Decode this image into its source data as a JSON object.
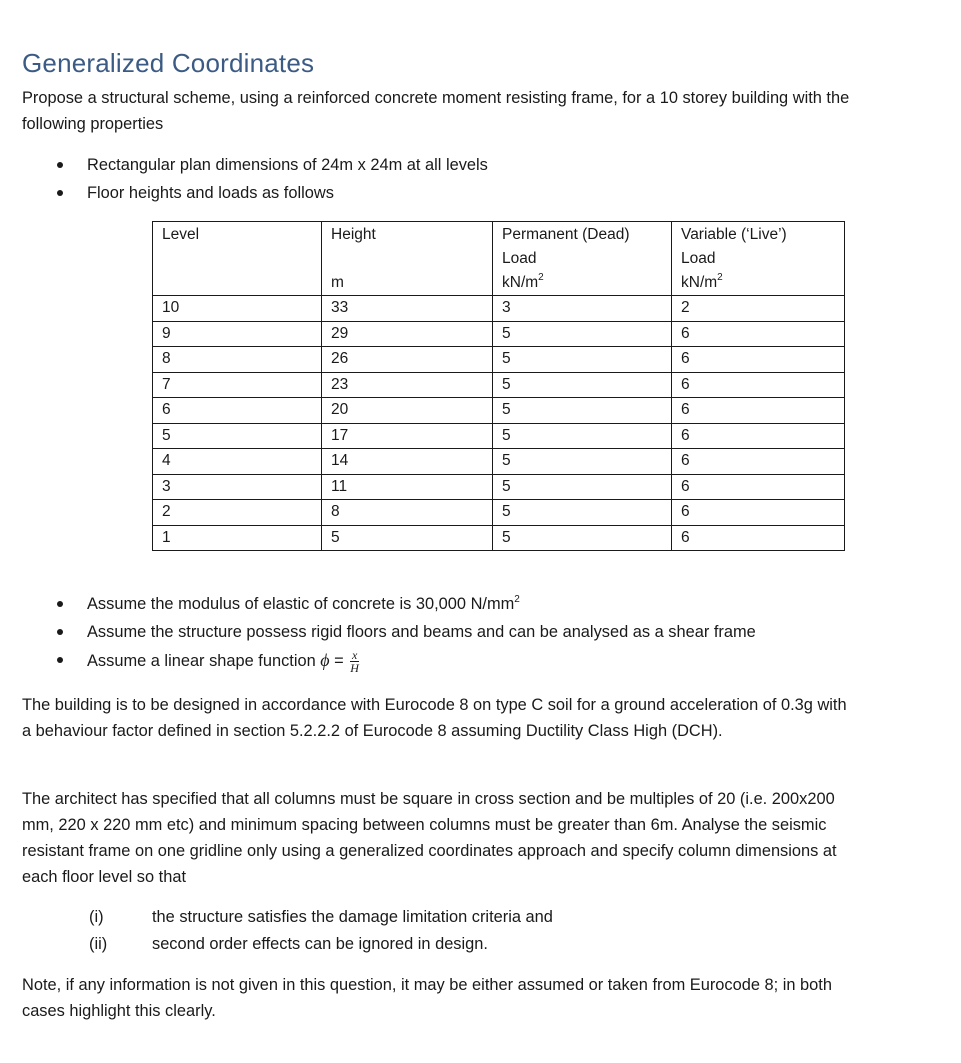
{
  "title": "Generalized Coordinates",
  "intro": "Propose a structural scheme, using a reinforced concrete moment resisting frame, for a 10 storey building with the following properties",
  "bullets_top": [
    "Rectangular plan dimensions of 24m x 24m at all levels",
    "Floor heights and loads as follows"
  ],
  "table": {
    "headers": {
      "level": "Level",
      "height": "Height",
      "height_unit": "m",
      "dead_line1": "Permanent (Dead)",
      "dead_line2": "Load",
      "dead_unit": "kN/m",
      "live_line1": "Variable (‘Live’)",
      "live_line2": "Load",
      "live_unit": "kN/m",
      "unit_exponent": "2"
    },
    "rows": [
      {
        "level": "10",
        "height": "33",
        "dead": "3",
        "live": "2"
      },
      {
        "level": "9",
        "height": "29",
        "dead": "5",
        "live": "6"
      },
      {
        "level": "8",
        "height": "26",
        "dead": "5",
        "live": "6"
      },
      {
        "level": "7",
        "height": "23",
        "dead": "5",
        "live": "6"
      },
      {
        "level": "6",
        "height": "20",
        "dead": "5",
        "live": "6"
      },
      {
        "level": "5",
        "height": "17",
        "dead": "5",
        "live": "6"
      },
      {
        "level": "4",
        "height": "14",
        "dead": "5",
        "live": "6"
      },
      {
        "level": "3",
        "height": "11",
        "dead": "5",
        "live": "6"
      },
      {
        "level": "2",
        "height": "8",
        "dead": "5",
        "live": "6"
      },
      {
        "level": "1",
        "height": "5",
        "dead": "5",
        "live": "6"
      }
    ]
  },
  "bullets_assume": {
    "modulus": "Assume the modulus of elastic of concrete is 30,000 N/mm",
    "modulus_exponent": "2",
    "shear_frame": "Assume the structure possess rigid floors and beams and can be analysed as a shear frame",
    "shape_fn": "Assume a linear shape function",
    "phi": "ϕ",
    "equals": " = ",
    "frac_num": "x",
    "frac_den": "H"
  },
  "para_eurocode": "The building is to be designed in accordance with Eurocode 8 on type C soil for a ground acceleration of 0.3g with a behaviour factor defined in section 5.2.2.2 of Eurocode 8 assuming Ductility Class High (DCH).",
  "para_architect": "The architect has specified that all columns must be square in cross section and be multiples of 20 (i.e. 200x200 mm, 220 x 220 mm etc) and minimum spacing between columns must be greater than 6m. Analyse the seismic resistant frame on one gridline only using a generalized coordinates approach and specify column dimensions at each floor level so that",
  "criteria": [
    {
      "num": "(i)",
      "text": "the structure satisfies the damage limitation criteria and"
    },
    {
      "num": "(ii)",
      "text": "second order effects can be ignored in design."
    }
  ],
  "note": "Note, if any information is not given in this question, it may be either assumed or taken from Eurocode 8; in both cases highlight this clearly."
}
